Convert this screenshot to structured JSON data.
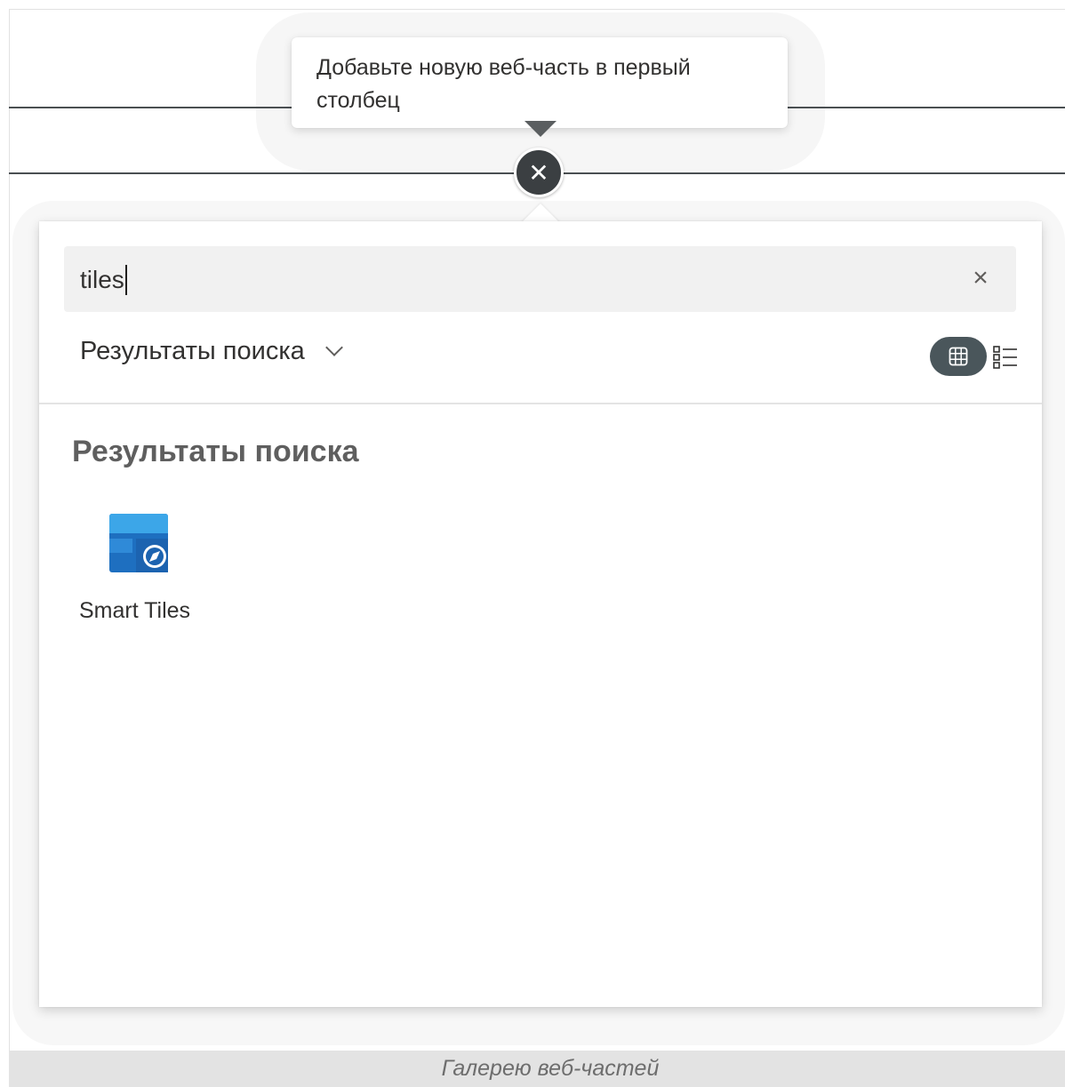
{
  "tooltip": {
    "text": "Добавьте новую веб-часть в первый столбец"
  },
  "toolbox": {
    "search": {
      "value": "tiles",
      "clear_icon": "close-icon"
    },
    "category": {
      "label": "Результаты поиска",
      "chevron_icon": "chevron-down-icon"
    },
    "view_toggle": {
      "grid_icon": "grid-view-icon",
      "list_icon": "list-view-icon",
      "selected": "grid"
    },
    "section_title": "Результаты поиска",
    "results": [
      {
        "label": "Smart Tiles",
        "icon": "smart-tiles-icon"
      }
    ]
  },
  "add_button": {
    "icon": "close-icon"
  },
  "caption": "Галерею веб-частей",
  "colors": {
    "accent_dark": "#3b3f42",
    "toggle_selected": "#4a565b",
    "search_bg": "#f1f1f1",
    "caption_bg": "#e3e3e3",
    "tile_blue": "#1f73c4",
    "tile_light": "#40a7e8"
  }
}
